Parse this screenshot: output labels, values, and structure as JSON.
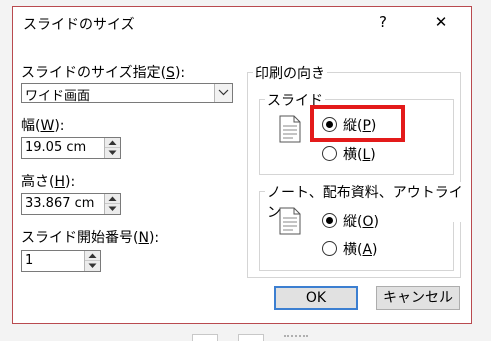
{
  "dialog": {
    "title": "スライドのサイズ",
    "help_label": "?",
    "close_label": "✕"
  },
  "slide_size": {
    "label_text": "スライドのサイズ指定(",
    "label_key": "S",
    "label_end": "):",
    "selected": "ワイド画面"
  },
  "width": {
    "label_text": "幅(",
    "label_key": "W",
    "label_end": "):",
    "value": "19.05 cm"
  },
  "height": {
    "label_text": "高さ(",
    "label_key": "H",
    "label_end": "):",
    "value": "33.867 cm"
  },
  "start_number": {
    "label_text": "スライド開始番号(",
    "label_key": "N",
    "label_end": "):",
    "value": "1"
  },
  "orientation": {
    "title": "印刷の向き",
    "slides": {
      "title": "スライド",
      "portrait": {
        "text": "縦(",
        "key": "P",
        "end": ")",
        "checked": true
      },
      "landscape": {
        "text": "横(",
        "key": "L",
        "end": ")",
        "checked": false
      }
    },
    "notes": {
      "title": "ノート、配布資料、アウトライン",
      "portrait": {
        "text": "縦(",
        "key": "O",
        "end": ")",
        "checked": true
      },
      "landscape": {
        "text": "横(",
        "key": "A",
        "end": ")",
        "checked": false
      }
    }
  },
  "buttons": {
    "ok": "OK",
    "cancel": "キャンセル"
  },
  "colors": {
    "highlight": "#e31a1a",
    "dialog_border": "#b94a4f",
    "default_button": "#3c7fd1"
  }
}
